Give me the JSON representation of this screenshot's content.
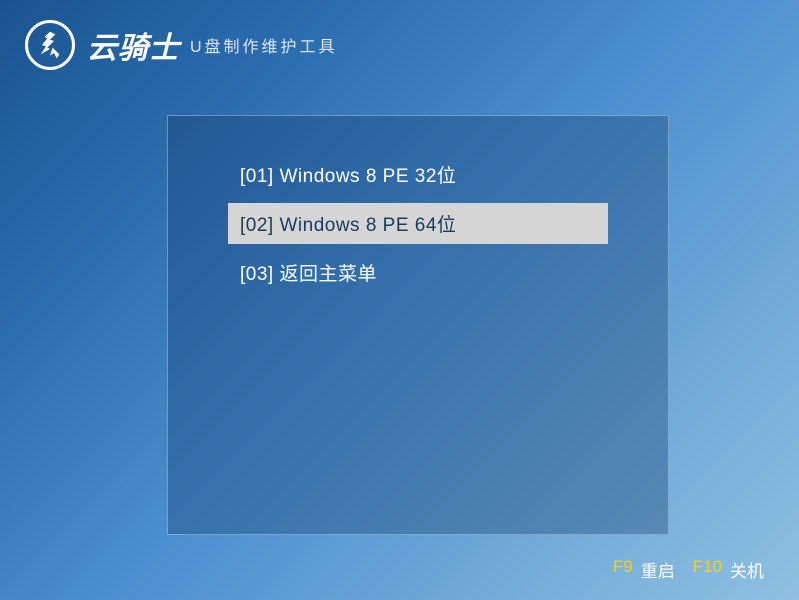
{
  "header": {
    "brand_name": "云骑士",
    "subtitle": "U盘制作维护工具"
  },
  "menu": {
    "items": [
      {
        "label": "[01] Windows 8 PE 32位",
        "selected": false
      },
      {
        "label": "[02] Windows 8 PE 64位",
        "selected": true
      },
      {
        "label": "[03] 返回主菜单",
        "selected": false
      }
    ]
  },
  "footer": {
    "restart_key": "F9",
    "restart_label": "重启",
    "shutdown_key": "F10",
    "shutdown_label": "关机"
  }
}
